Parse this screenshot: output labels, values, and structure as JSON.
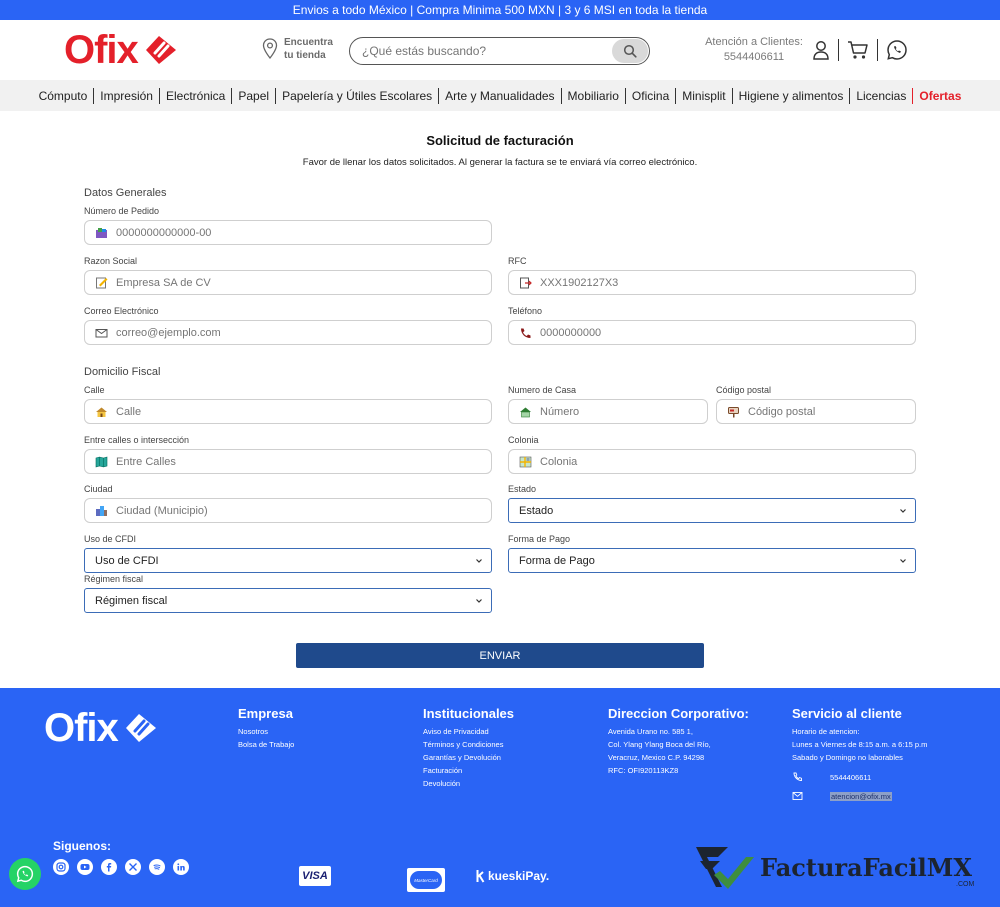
{
  "topbar": {
    "text": "Envios a todo México | Compra Minima 500 MXN | 3 y 6 MSI en toda la tienda"
  },
  "header": {
    "logo_text": "Ofix",
    "store_line1": "Encuentra",
    "store_line2": "tu tienda",
    "search_placeholder": "¿Qué estás buscando?",
    "attention_label": "Atención a Clientes:",
    "attention_phone": "5544406611"
  },
  "nav": {
    "items": [
      "Cómputo",
      "Impresión",
      "Electrónica",
      "Papel",
      "Papelería y Útiles Escolares",
      "Arte y Manualidades",
      "Mobiliario",
      "Oficina",
      "Minisplit",
      "Higiene y alimentos",
      "Licencias"
    ],
    "offers": "Ofertas"
  },
  "form": {
    "title": "Solicitud de facturación",
    "subtitle": "Favor de llenar los datos solicitados. Al generar la factura se te enviará vía correo electrónico.",
    "section_general": "Datos Generales",
    "section_fiscal": "Domicilio Fiscal",
    "order_label": "Número de Pedido",
    "order_placeholder": "0000000000000-00",
    "razon_label": "Razon Social",
    "razon_placeholder": "Empresa SA de CV",
    "rfc_label": "RFC",
    "rfc_placeholder": "XXX1902127X3",
    "email_label": "Correo Electrónico",
    "email_placeholder": "correo@ejemplo.com",
    "phone_label": "Teléfono",
    "phone_placeholder": "0000000000",
    "street_label": "Calle",
    "street_placeholder": "Calle",
    "house_label": "Numero de Casa",
    "house_placeholder": "Número",
    "zip_label": "Código postal",
    "zip_placeholder": "Código postal",
    "between_label": "Entre calles o intersección",
    "between_placeholder": "Entre Calles",
    "colonia_label": "Colonia",
    "colonia_placeholder": "Colonia",
    "city_label": "Ciudad",
    "city_placeholder": "Ciudad (Municipio)",
    "state_label": "Estado",
    "state_value": "Estado",
    "cfdi_label": "Uso de CFDI",
    "cfdi_value": "Uso de CFDI",
    "payment_label": "Forma de Pago",
    "payment_value": "Forma de Pago",
    "regimen_label": "Régimen fiscal",
    "regimen_value": "Régimen fiscal",
    "submit": "ENVIAR"
  },
  "footer": {
    "logo_text": "Ofix",
    "empresa": {
      "title": "Empresa",
      "links": [
        "Nosotros",
        "Bolsa de Trabajo"
      ]
    },
    "institucionales": {
      "title": "Institucionales",
      "links": [
        "Aviso de Privacidad",
        "Términos y Condiciones",
        "Garantías y Devolución",
        "Facturación",
        "Devolución"
      ]
    },
    "corporativo": {
      "title": "Direccion Corporativo:",
      "lines": [
        "Avenida Urano no. 585 1,",
        "Col. Ylang Ylang Boca del Río,",
        "Veracruz, Mexico C.P. 94298",
        "RFC: OFI920113KZ8"
      ]
    },
    "servicio": {
      "title": "Servicio al cliente",
      "lines": [
        "Horario de atencion:",
        "Lunes a Viernes de 8:15 a.m. a 6:15 p.m",
        "Sabado y Domingo no laborables"
      ],
      "phone": "5544406611",
      "email": "atencion@ofix.mx"
    },
    "follow": "Siguenos:",
    "payments": {
      "visa": "VISA",
      "mastercard": "MasterCard",
      "kueski": "kueskiPay."
    }
  },
  "watermark": {
    "text": "FacturaFacilMX",
    "suffix": ".COM"
  },
  "colors": {
    "brand_red": "#e4202a",
    "brand_blue": "#2a64f5",
    "button_blue": "#1f4a8c",
    "whatsapp": "#25d366"
  }
}
